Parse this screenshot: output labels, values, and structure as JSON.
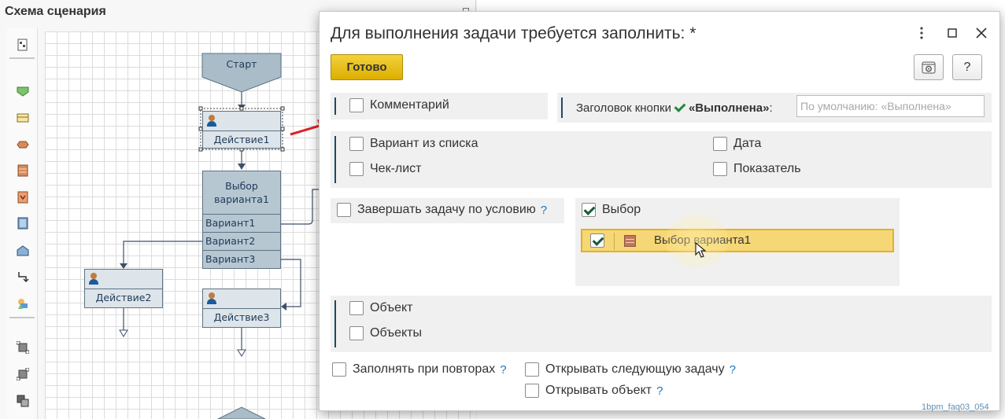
{
  "scheme": {
    "title": "Схема сценария",
    "nodes": {
      "start": "Старт",
      "action1": "Действие1",
      "choice_title_line1": "Выбор",
      "choice_title_line2": "варианта1",
      "variant1": "Вариант1",
      "variant2": "Вариант2",
      "variant3": "Вариант3",
      "action2": "Действие2",
      "action3": "Действие3"
    }
  },
  "dialog": {
    "title": "Для выполнения задачи требуется заполнить: *",
    "ready_button": "Готово",
    "help_button": "?",
    "comment": {
      "label": "Комментарий",
      "checked": false
    },
    "button_header": {
      "prefix": "Заголовок кнопки",
      "bold_label": "«Выполнена»",
      "suffix": ":",
      "input_value": "",
      "input_placeholder": "По умолчанию: «Выполнена»"
    },
    "list_variant": {
      "label": "Вариант из списка",
      "checked": false
    },
    "date": {
      "label": "Дата",
      "checked": false
    },
    "checklist": {
      "label": "Чек-лист",
      "checked": false
    },
    "indicator": {
      "label": "Показатель",
      "checked": false
    },
    "finish_by_condition": {
      "label": "Завершать задачу по условию",
      "help": "?",
      "checked": false
    },
    "choice": {
      "label": "Выбор",
      "checked": true
    },
    "choice_item": {
      "label": "Выбор варианта1",
      "checked": true
    },
    "object": {
      "label": "Объект",
      "checked": false
    },
    "objects": {
      "label": "Объекты",
      "checked": false
    },
    "fill_on_repeat": {
      "label": "Заполнять при повторах",
      "help": "?",
      "checked": false
    },
    "open_next_task": {
      "label": "Открывать следующую задачу",
      "help": "?",
      "checked": false
    },
    "open_object": {
      "label": "Открывать объект",
      "help": "?",
      "checked": false
    }
  },
  "watermark": "1bpm_faq03_054",
  "colors": {
    "accent_yellow": "#dcae00",
    "selection": "#f6d776",
    "node_fill": "#dde5ea",
    "node_choice_fill": "#b6c7d2",
    "node_border": "#5d7384",
    "group_bar": "#1e4a64",
    "check_green": "#1f8a3a",
    "help_blue": "#1f73b7",
    "arrow_red": "#e02020"
  },
  "icons": [
    "map-icon",
    "action-icon",
    "form-icon",
    "condition-icon",
    "choice-icon",
    "subprocess-icon",
    "table-icon",
    "end-icon",
    "connector-icon",
    "group-icon",
    "align-icon",
    "align-icon-2",
    "stack-icon",
    "settings-icon",
    "help-icon",
    "kebab-menu-icon",
    "maximize-icon",
    "close-icon",
    "person-icon",
    "cursor-icon"
  ]
}
